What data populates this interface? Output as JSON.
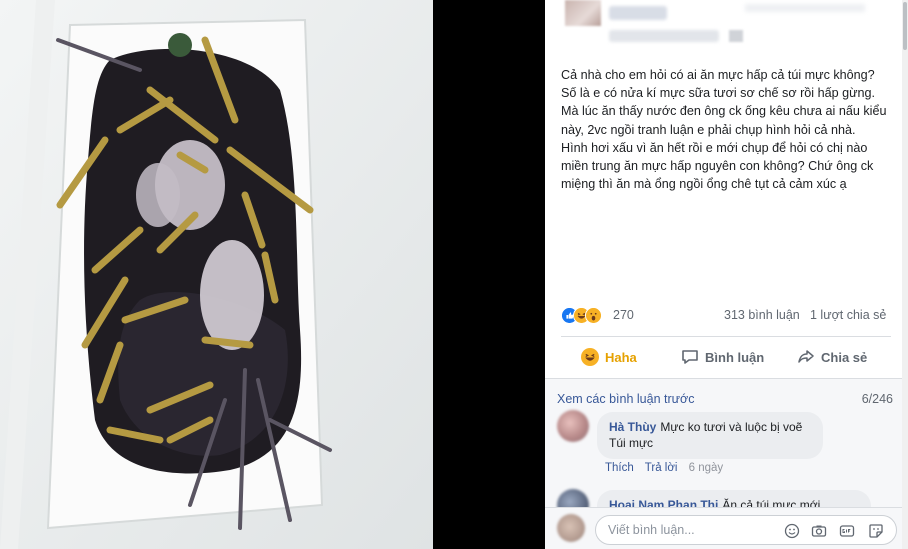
{
  "post": {
    "author_name": "",
    "paragraphs": [
      "Cả nhà cho em hỏi có ai ăn mực hấp cả túi mực không? Số là e có nửa kí mực sữa tươi sơ chế sơ rồi hấp gừng. Mà lúc ăn thấy nước đen ông ck ống kêu chưa ai nấu kiểu này, 2vc ngồi tranh luận e phải chụp hình hỏi cả nhà.",
      "Hình hơi xấu vì ăn hết rồi e mới chụp để hỏi có chị nào miền trung ăn mực hấp nguyên con không? Chứ ông ck miệng thì ăn mà ổng ngồi ổng chê tụt cả cảm xúc ạ"
    ],
    "reaction_count": "270",
    "comment_count": "313 bình luận",
    "share_count": "1 lượt chia sẻ"
  },
  "actions": {
    "haha": "Haha",
    "comment": "Bình luận",
    "share": "Chia sẻ"
  },
  "comments": {
    "view_previous": "Xem các bình luận trước",
    "pager": "6/246",
    "items": [
      {
        "name": "Hà Thùy",
        "text": "Mực ko tươi và luộc bị voẽ Túi mực",
        "like": "Thích",
        "reply": "Trả lời",
        "time": "6 ngày"
      },
      {
        "name": "Hoai Nam Phan Thi",
        "text": "Ăn cả túi mực mới"
      }
    ],
    "write_placeholder": "Viết bình luận..."
  },
  "colors": {
    "link": "#385898",
    "haha": "#e6a100",
    "like_blue": "#1877f2"
  },
  "icons": {
    "reactions": [
      "like-icon",
      "haha-icon",
      "wow-icon"
    ],
    "composer": [
      "emoji-icon",
      "camera-icon",
      "gif-icon",
      "sticker-icon"
    ]
  }
}
